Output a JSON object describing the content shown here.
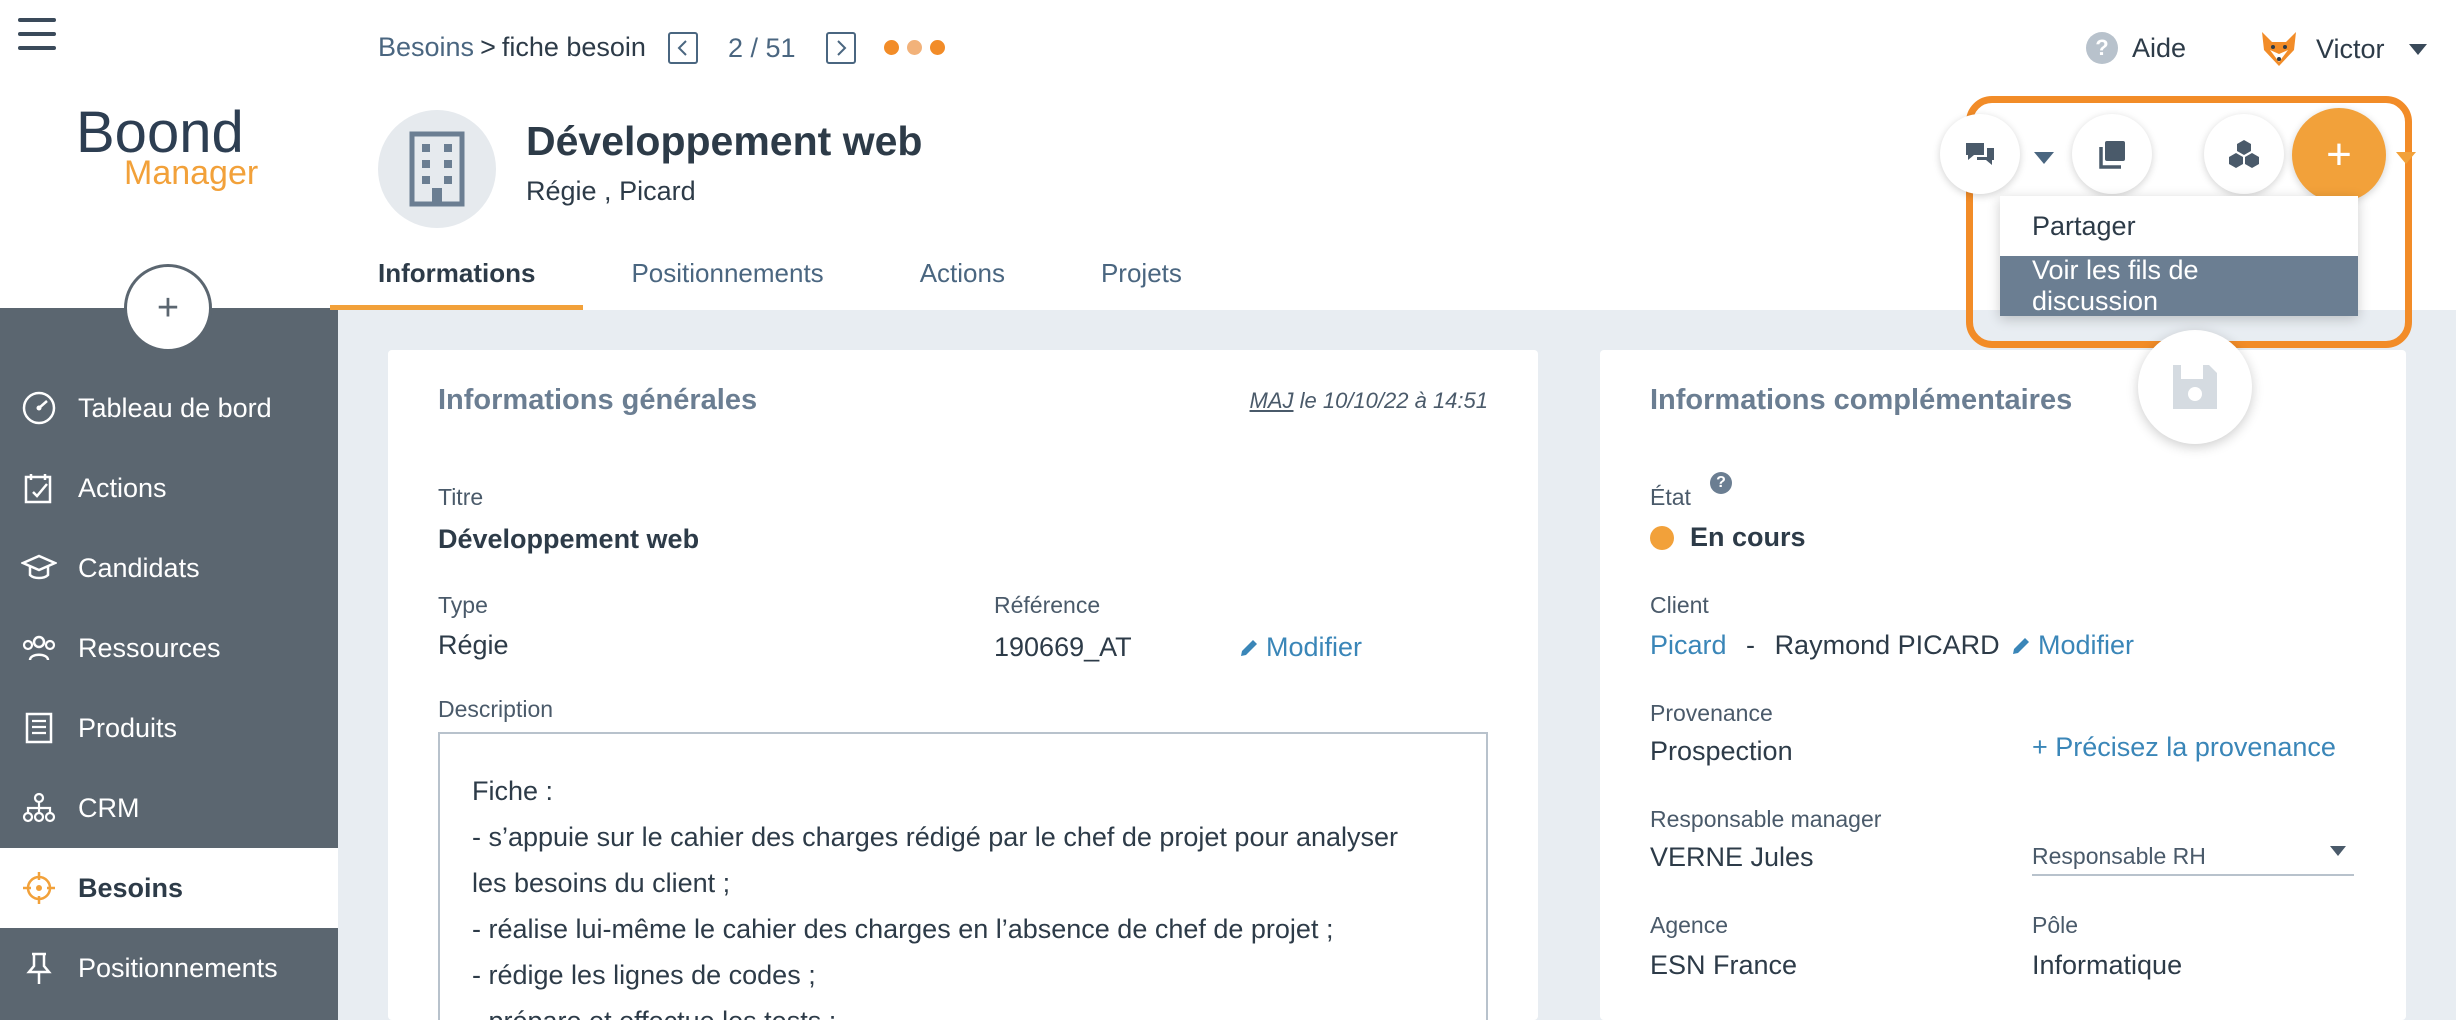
{
  "breadcrumb": {
    "parent": "Besoins",
    "separator": ">",
    "current": "fiche besoin"
  },
  "pager": {
    "position": "2 / 51"
  },
  "status_dots": [
    "#f28c28",
    "#f2a13a",
    "#f28c28"
  ],
  "header": {
    "help_label": "Aide",
    "user_name": "Victor"
  },
  "logo": {
    "line1": "Boond",
    "line2": "Manager"
  },
  "sidebar": {
    "add_label": "+",
    "items": [
      {
        "label": "Tableau de bord",
        "icon": "dashboard-icon"
      },
      {
        "label": "Actions",
        "icon": "actions-icon"
      },
      {
        "label": "Candidats",
        "icon": "candidates-icon"
      },
      {
        "label": "Ressources",
        "icon": "resources-icon"
      },
      {
        "label": "Produits",
        "icon": "products-icon"
      },
      {
        "label": "CRM",
        "icon": "crm-icon"
      },
      {
        "label": "Besoins",
        "icon": "target-icon",
        "active": true
      },
      {
        "label": "Positionnements",
        "icon": "pin-icon"
      }
    ]
  },
  "entity": {
    "title": "Développement web",
    "subtitle_type": "Régie",
    "subtitle_sep": " , ",
    "subtitle_company": "Picard"
  },
  "tabs": [
    {
      "label": "Informations",
      "active": true
    },
    {
      "label": "Positionnements"
    },
    {
      "label": "Actions"
    },
    {
      "label": "Projets"
    }
  ],
  "actions": {
    "plus_label": "+",
    "menu": [
      {
        "label": "Partager"
      },
      {
        "label": "Voir les fils de discussion",
        "hover": true
      }
    ]
  },
  "general": {
    "title": "Informations générales",
    "updated_prefix": "MAJ",
    "updated_rest": " le 10/10/22 à 14:51",
    "titre_label": "Titre",
    "titre_value": "Développement web",
    "type_label": "Type",
    "type_value": "Régie",
    "ref_label": "Référence",
    "ref_value": "190669_AT",
    "modify_label": "Modifier",
    "desc_label": "Description",
    "desc_lines": [
      "Fiche :",
      " -   s’appuie sur le cahier des charges rédigé par le chef de projet pour analyser",
      "les besoins du client ;",
      "-    réalise lui-même le cahier des charges en l’absence de chef de projet ;",
      "-    rédige les lignes de codes ;",
      "-    prépare et effectue les tests ;"
    ]
  },
  "complementary": {
    "title": "Informations complémentaires",
    "state_label": "État",
    "state_value": "En cours",
    "state_color": "#f2a13a",
    "client_label": "Client",
    "client_company": "Picard",
    "client_sep": "-",
    "client_contact": "Raymond PICARD",
    "modify_label": "Modifier",
    "origin_label": "Provenance",
    "origin_value": "Prospection",
    "origin_action": "+ Précisez la provenance",
    "manager_label": "Responsable manager",
    "manager_value": "VERNE Jules",
    "rh_placeholder": "Responsable RH",
    "agency_label": "Agence",
    "agency_value": "ESN France",
    "pole_label": "Pôle",
    "pole_value": "Informatique"
  }
}
